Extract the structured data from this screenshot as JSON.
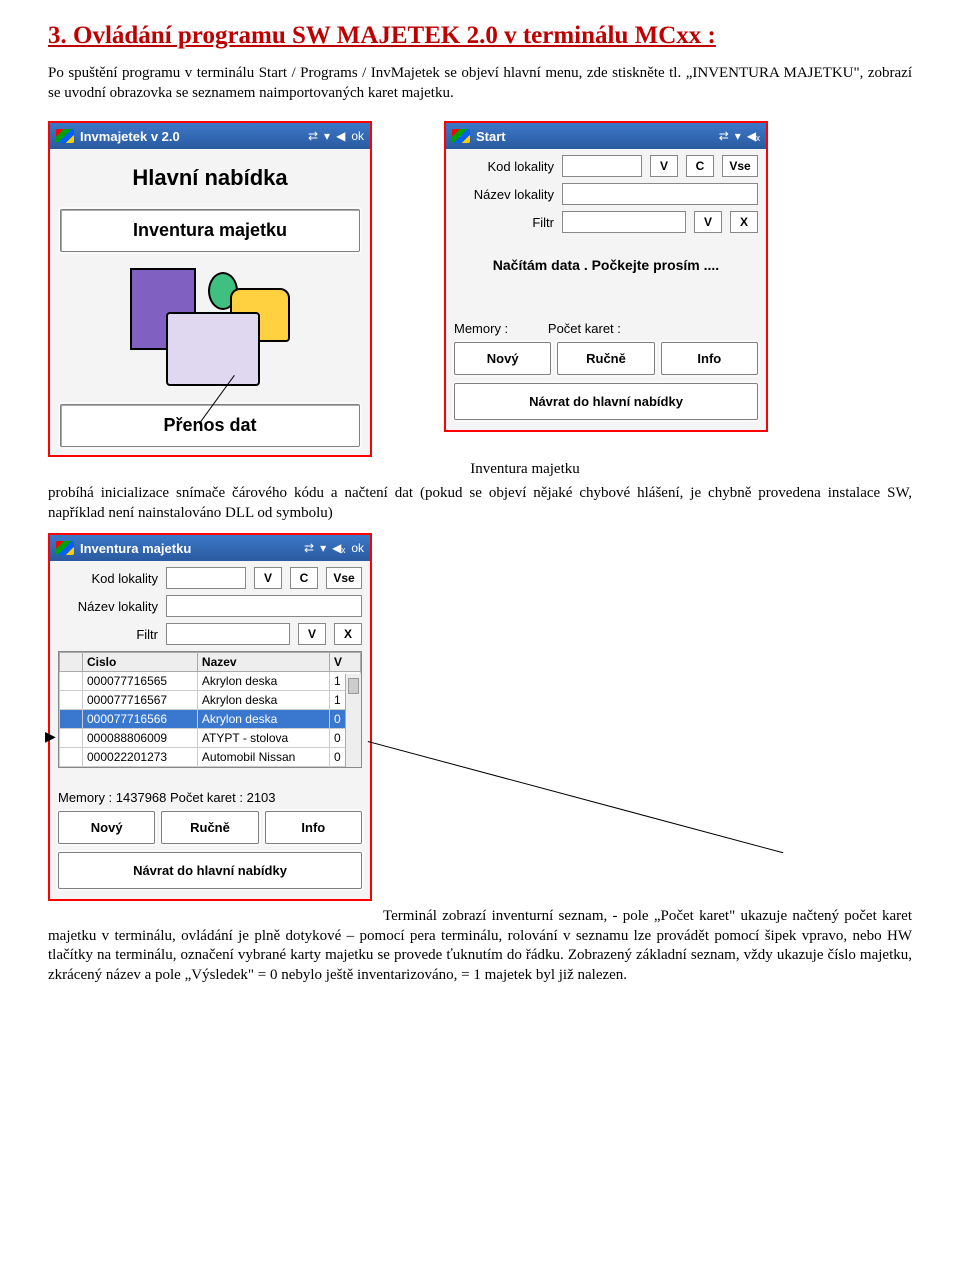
{
  "heading": "3. Ovládání programu SW MAJETEK 2.0 v terminálu MCxx  :",
  "intro1": "Po spuštění programu v terminálu Start / Programs / InvMajetek se objeví hlavní menu, zde stiskněte tl. „INVENTURA MAJETKU\", zobrazí se uvodní obrazovka se seznamem naimportovaných karet majetku.",
  "phone1": {
    "title": "Invmajetek v 2.0",
    "tray_ok": "ok",
    "menu_title": "Hlavní nabídka",
    "btn_inv": "Inventura majetku",
    "btn_prenos": "Přenos dat"
  },
  "phone2": {
    "title": "Start",
    "lab_kod": "Kod lokality",
    "lab_nazev": "Název lokality",
    "lab_filtr": "Filtr",
    "btn_v": "V",
    "btn_c": "C",
    "btn_vse": "Vse",
    "btn_x": "X",
    "status": "Načítám data . Počkejte prosím ....",
    "foot_mem": "Memory :",
    "foot_cnt": "Počet karet :",
    "btn_novy": "Nový",
    "btn_rucne": "Ručně",
    "btn_info": "Info",
    "btn_back": "Návrat do hlavní nabídky"
  },
  "caption_inv": "Inventura   majetku",
  "para_mid": "probíhá inicializace snímače čárového kódu a načtení dat (pokud se objeví nějaké chybové hlášení,  je chybně provedena instalace SW, například není nainstalováno DLL od symbolu)",
  "phone3": {
    "title": "Inventura majetku",
    "tray_ok": "ok",
    "lab_kod": "Kod lokality",
    "lab_nazev": "Název lokality",
    "lab_filtr": "Filtr",
    "btn_v": "V",
    "btn_c": "C",
    "btn_vse": "Vse",
    "btn_x": "X",
    "col_cislo": "Cislo",
    "col_nazev": "Nazev",
    "col_v": "V",
    "rows": [
      {
        "c": "000077716565",
        "n": "Akrylon deska",
        "v": "1"
      },
      {
        "c": "000077716567",
        "n": "Akrylon deska",
        "v": "1"
      },
      {
        "c": "000077716566",
        "n": "Akrylon deska",
        "v": "0"
      },
      {
        "c": "000088806009",
        "n": "ATYPT - stolova",
        "v": "0"
      },
      {
        "c": "000022201273",
        "n": "Automobil Nissan",
        "v": "0"
      }
    ],
    "footline": "Memory : 1437968 Počet karet : 2103",
    "btn_novy": "Nový",
    "btn_rucne": "Ručně",
    "btn_info": "Info",
    "btn_back": "Návrat do hlavní nabídky"
  },
  "para_end_lead": "Terminál zobrazí inventurní seznam,   -  pole „Počet karet\" ukazuje načtený",
  "para_end": "počet karet majetku v terminálu, ovládání je plně dotykové – pomocí pera terminálu, rolování v seznamu lze provádět pomocí šipek vpravo, nebo HW tlačítky na terminálu, označení vybrané karty majetku se provede ťuknutím do řádku. Zobrazený základní seznam, vždy ukazuje číslo majetku, zkrácený název a pole „Výsledek\" = 0 nebylo ještě inventarizováno, = 1 majetek byl již nalezen."
}
